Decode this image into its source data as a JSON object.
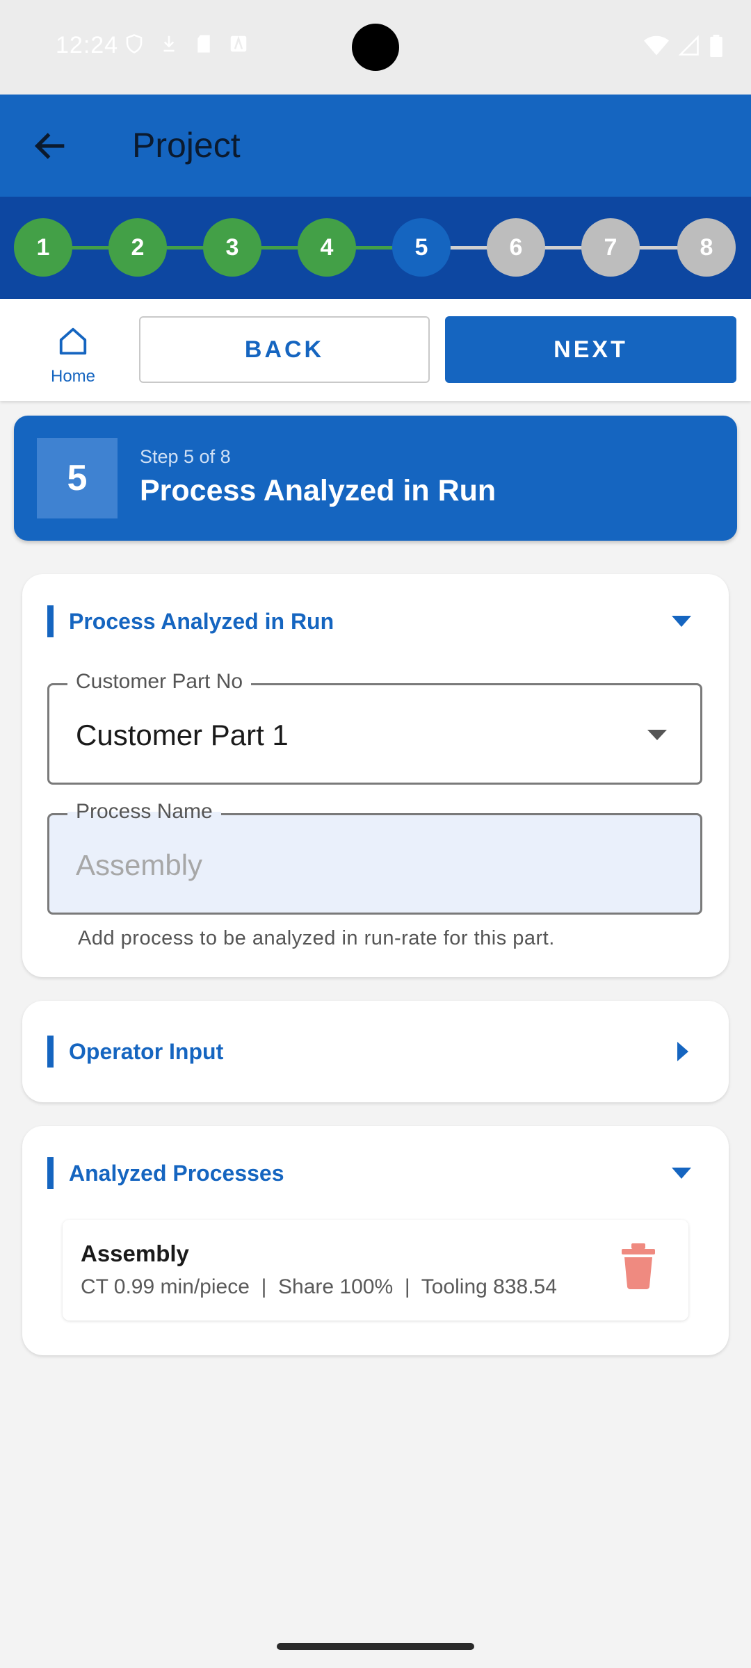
{
  "status_bar": {
    "time": "12:24",
    "left_icons": [
      "shield-icon",
      "download-icon",
      "sd-card-icon",
      "a-icon"
    ],
    "right_icons": [
      "wifi-icon",
      "signal-icon",
      "battery-icon"
    ]
  },
  "app_bar": {
    "title": "Project"
  },
  "stepper": {
    "steps": [
      {
        "label": "1",
        "state": "completed"
      },
      {
        "label": "2",
        "state": "completed"
      },
      {
        "label": "3",
        "state": "completed"
      },
      {
        "label": "4",
        "state": "completed"
      },
      {
        "label": "5",
        "state": "current"
      },
      {
        "label": "6",
        "state": "pending"
      },
      {
        "label": "7",
        "state": "pending"
      },
      {
        "label": "8",
        "state": "pending"
      }
    ],
    "colors": {
      "completed": "#43a047",
      "current": "#1565c0",
      "pending": "#bdbdbd"
    }
  },
  "nav": {
    "home_label": "Home",
    "back_label": "BACK",
    "next_label": "NEXT"
  },
  "step_header": {
    "number": "5",
    "subtitle": "Step 5 of 8",
    "title": "Process Analyzed in Run"
  },
  "sections": {
    "process": {
      "title": "Process Analyzed in Run",
      "customer_part": {
        "label": "Customer Part No",
        "value": "Customer Part 1"
      },
      "process_name": {
        "label": "Process Name",
        "placeholder": "Assembly"
      },
      "helper": "Add process to be analyzed in run-rate for this part."
    },
    "operator": {
      "title": "Operator Input"
    },
    "analyzed": {
      "title": "Analyzed Processes",
      "items": [
        {
          "name": "Assembly",
          "details": "CT 0.99 min/piece  |  Share 100%  |  Tooling 838.54"
        }
      ]
    }
  },
  "colors": {
    "primary": "#1565c0",
    "primary_dark": "#0d47a1",
    "delete": "#ef8a80"
  }
}
